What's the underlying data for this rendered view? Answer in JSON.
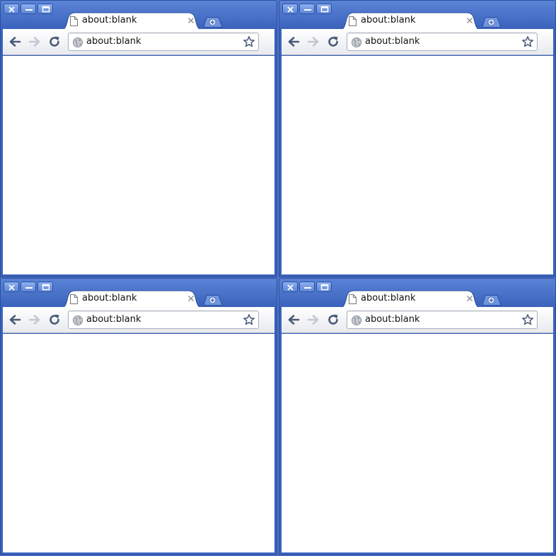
{
  "windows": [
    {
      "tab_title": "about:blank",
      "url": "about:blank"
    },
    {
      "tab_title": "about:blank",
      "url": "about:blank"
    },
    {
      "tab_title": "about:blank",
      "url": "about:blank"
    },
    {
      "tab_title": "about:blank",
      "url": "about:blank"
    }
  ],
  "icons": {
    "close": "close-icon",
    "minimize": "minimize-icon",
    "maximize": "maximize-icon",
    "page": "page-icon",
    "tab_close": "tab-close-icon",
    "new_tab": "new-tab-icon",
    "back": "back-arrow-icon",
    "forward": "forward-arrow-icon",
    "reload": "reload-icon",
    "globe": "globe-icon",
    "bookmark": "star-icon"
  },
  "colors": {
    "frame": "#3a62bc",
    "toolbar": "#eef0f4",
    "content": "#ffffff"
  }
}
